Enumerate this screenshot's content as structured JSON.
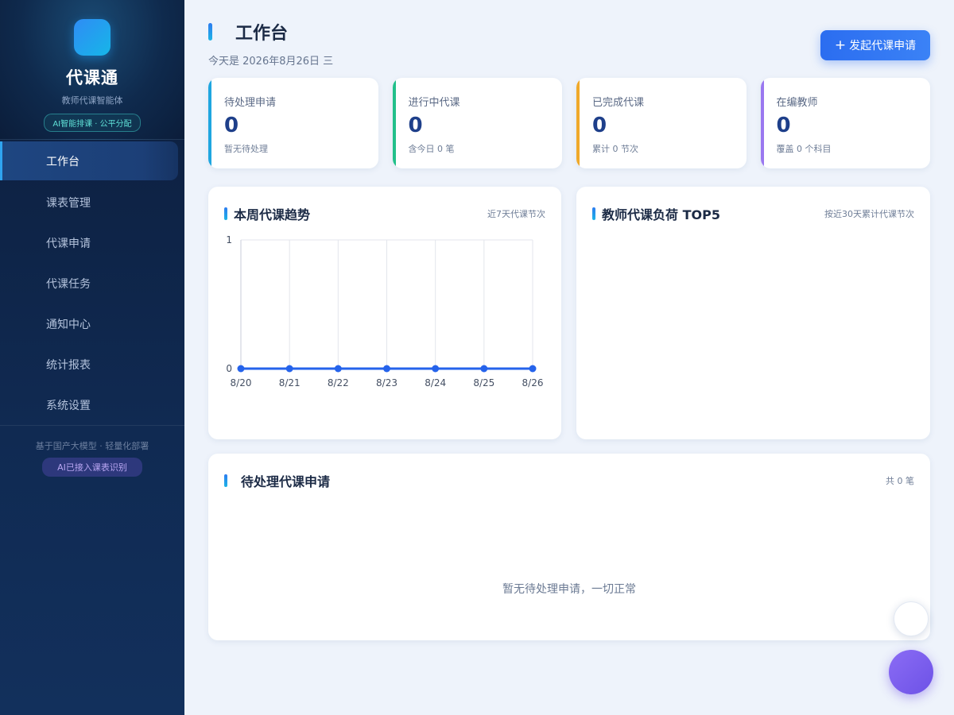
{
  "sidebar": {
    "brand_name": "代课通",
    "brand_sub": "教师代课智能体",
    "brand_badge": "AI智能排课 · 公平分配",
    "items": [
      {
        "label": "工作台",
        "active": true
      },
      {
        "label": "课表管理"
      },
      {
        "label": "代课申请"
      },
      {
        "label": "代课任务"
      },
      {
        "label": "通知中心"
      },
      {
        "label": "统计报表"
      },
      {
        "label": "系统设置"
      }
    ],
    "footer_text": "基于国产大模型 · 轻量化部署",
    "footer_badge": "AI已接入课表识别"
  },
  "header": {
    "title": "工作台",
    "date": "今天是 2026年8月26日 三",
    "primary_button": "发起代课申请"
  },
  "stats": [
    {
      "label": "待处理申请",
      "value": "0",
      "note": "暂无待处理",
      "accent": "#1fa6e0"
    },
    {
      "label": "进行中代课",
      "value": "0",
      "note": "含今日 0 笔",
      "accent": "#22c08a"
    },
    {
      "label": "已完成代课",
      "value": "0",
      "note": "累计 0 节次",
      "accent": "#f0a92a"
    },
    {
      "label": "在编教师",
      "value": "0",
      "note": "覆盖 0 个科目",
      "accent": "#9a78f0"
    }
  ],
  "trend_panel": {
    "title": "本周代课趋势",
    "subtitle": "近7天代课节次"
  },
  "load_panel": {
    "title": "教师代课负荷 TOP5",
    "subtitle": "按近30天累计代课节次"
  },
  "pending_panel": {
    "title": "待处理代课申请",
    "count_text": "共 0 笔",
    "empty_text": "暂无待处理申请，一切正常"
  },
  "chart_data": {
    "type": "line",
    "x": [
      "8/20",
      "8/21",
      "8/22",
      "8/23",
      "8/24",
      "8/25",
      "8/26"
    ],
    "values": [
      0,
      0,
      0,
      0,
      0,
      0,
      0
    ],
    "ylim": [
      0,
      1
    ],
    "yticks": [
      "0",
      "1"
    ],
    "grid": true,
    "color": "#2563eb"
  }
}
